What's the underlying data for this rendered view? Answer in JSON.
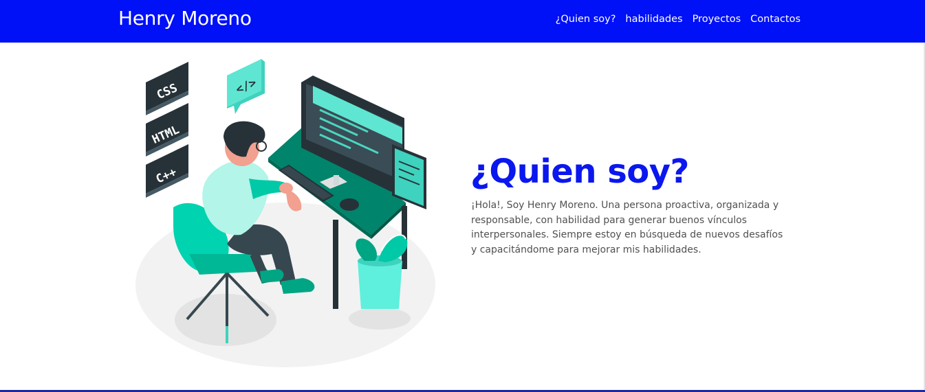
{
  "header": {
    "brand": "Henry Moreno",
    "brand_color": "#0010f7",
    "nav": [
      {
        "label": "¿Quien soy?"
      },
      {
        "label": "habilidades"
      },
      {
        "label": "Proyectos"
      },
      {
        "label": "Contactos"
      }
    ]
  },
  "hero": {
    "illustration": {
      "icon": "developer-at-desk-illustration",
      "badges": [
        "CSS",
        "HTML",
        "C++",
        "</>"
      ]
    },
    "title": "¿Quien soy?",
    "title_color": "#0a17ee",
    "description": "¡Hola!, Soy Henry Moreno. Una persona proactiva, organizada y responsable, con habilidad para generar buenos vínculos interpersonales. Siempre estoy en búsqueda de nuevos desafíos y capacitándome para mejorar mis habilidades."
  }
}
